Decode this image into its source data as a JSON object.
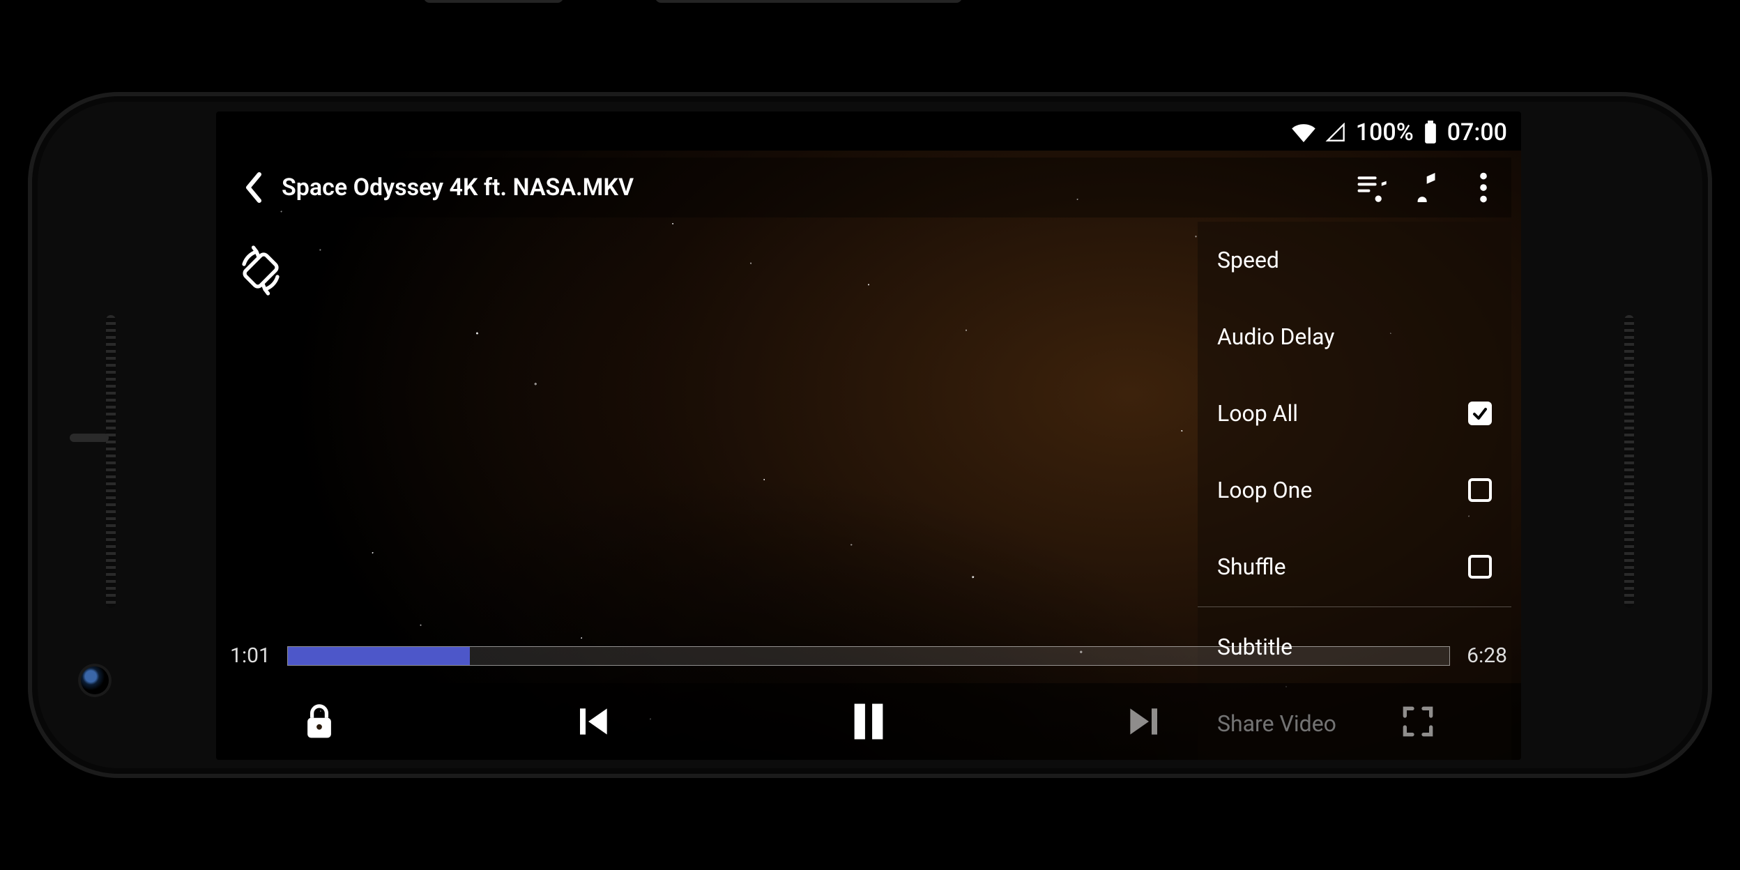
{
  "statusbar": {
    "battery_pct": "100%",
    "clock": "07:00"
  },
  "titlebar": {
    "title": "Space Odyssey 4K ft. NASA.MKV"
  },
  "progress": {
    "elapsed": "1:01",
    "total": "6:28",
    "percent": 15.7
  },
  "menu": {
    "items": [
      {
        "label": "Speed",
        "has_checkbox": false,
        "checked": false
      },
      {
        "label": "Audio Delay",
        "has_checkbox": false,
        "checked": false
      },
      {
        "label": "Loop All",
        "has_checkbox": true,
        "checked": true
      },
      {
        "label": "Loop One",
        "has_checkbox": true,
        "checked": false
      },
      {
        "label": "Shuffle",
        "has_checkbox": true,
        "checked": false
      },
      {
        "label": "Subtitle",
        "has_checkbox": false,
        "checked": false
      },
      {
        "label": "Share Video",
        "has_checkbox": false,
        "checked": false
      }
    ],
    "divider_after_index": 4
  },
  "colors": {
    "progress_fill": "#4d57c9"
  }
}
